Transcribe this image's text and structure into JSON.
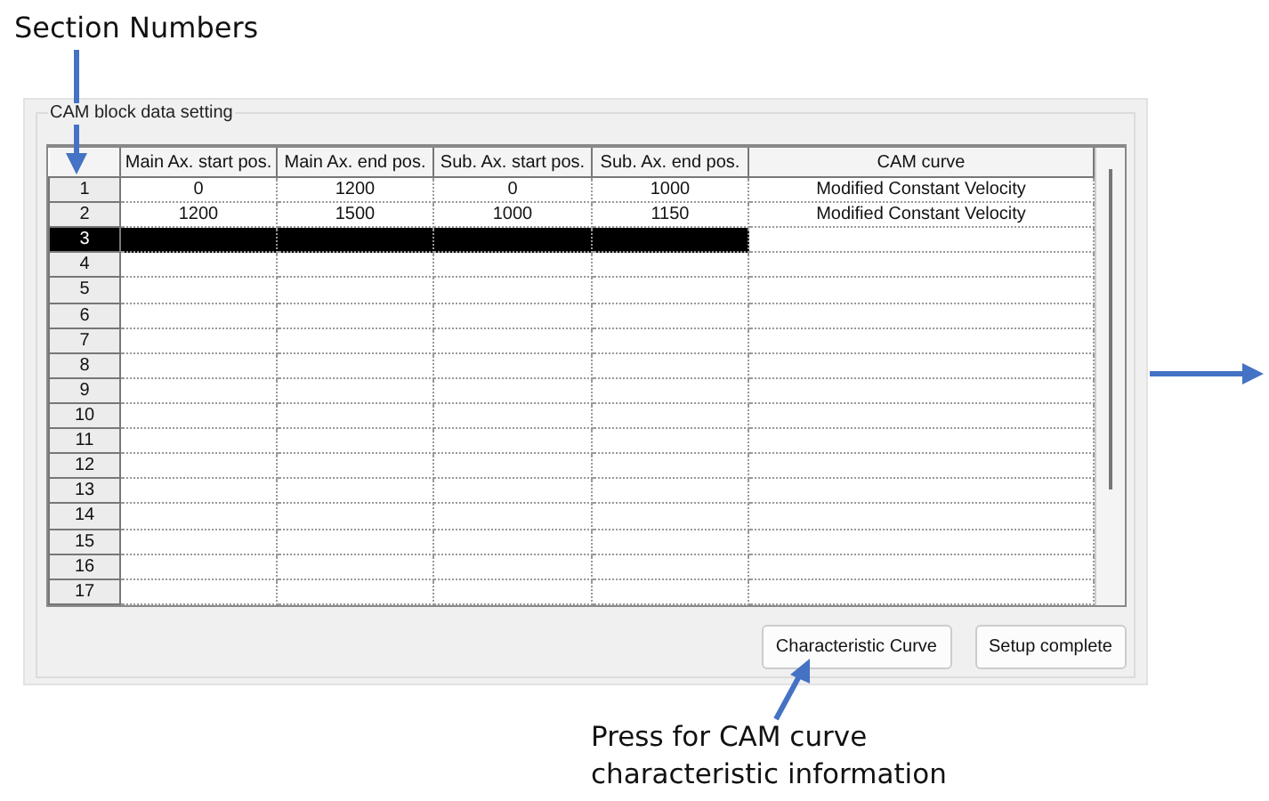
{
  "annotations": {
    "section_label": "Section Numbers",
    "button_note": "Press for CAM curve characteristic information"
  },
  "panel": {
    "title": "CAM block data setting"
  },
  "table": {
    "columns": [
      "Main Ax. start pos.",
      "Main Ax. end pos.",
      "Sub. Ax. start pos.",
      "Sub. Ax. end pos.",
      "CAM curve"
    ],
    "rows": [
      {
        "number": "1",
        "selected": false,
        "cells": [
          "0",
          "1200",
          "0",
          "1000",
          "Modified Constant Velocity"
        ]
      },
      {
        "number": "2",
        "selected": false,
        "cells": [
          "1200",
          "1500",
          "1000",
          "1150",
          "Modified Constant Velocity"
        ]
      },
      {
        "number": "3",
        "selected": true
      },
      {
        "number": "4",
        "selected": false
      },
      {
        "number": "5",
        "selected": false
      },
      {
        "number": "6",
        "selected": false
      },
      {
        "number": "7",
        "selected": false
      },
      {
        "number": "8",
        "selected": false
      },
      {
        "number": "9",
        "selected": false
      },
      {
        "number": "10",
        "selected": false
      },
      {
        "number": "11",
        "selected": false
      },
      {
        "number": "12",
        "selected": false
      },
      {
        "number": "13",
        "selected": false
      },
      {
        "number": "14",
        "selected": false
      },
      {
        "number": "15",
        "selected": false
      },
      {
        "number": "16",
        "selected": false
      },
      {
        "number": "17",
        "selected": false
      }
    ]
  },
  "buttons": [
    "Characteristic Curve",
    "Setup complete"
  ]
}
